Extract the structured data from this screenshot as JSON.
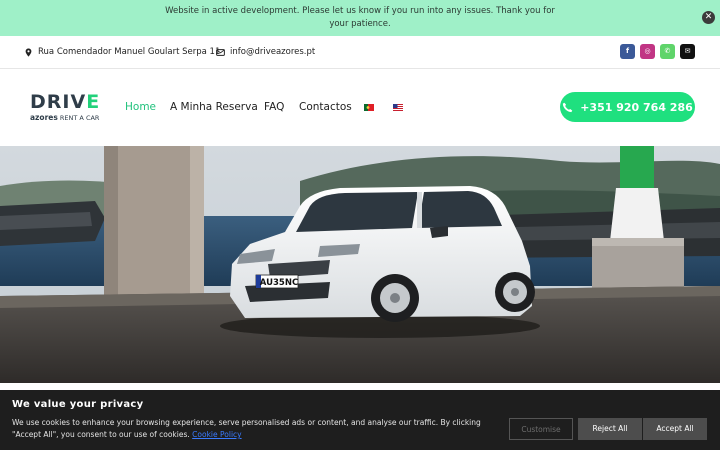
{
  "notice": {
    "text": "Website in active development. Please let us know if you run into any issues. Thank you for your patience.",
    "close_icon": "close-icon"
  },
  "contact": {
    "address": "Rua Comendador Manuel Goulart Serpa 11",
    "email": "info@driveazores.pt",
    "social": [
      {
        "name": "facebook",
        "glyph": "f",
        "color": "#3b5998"
      },
      {
        "name": "instagram",
        "glyph": "◎",
        "color": "#c13584"
      },
      {
        "name": "whatsapp",
        "glyph": "✆",
        "color": "#5fd46a"
      },
      {
        "name": "email",
        "glyph": "✉",
        "color": "#111111"
      }
    ]
  },
  "nav": {
    "logo_main_a": "DRIV",
    "logo_main_b": "E",
    "logo_sub_a": "azores",
    "logo_sub_b": " RENT A CAR",
    "items": [
      "Home",
      "A Minha Reserva",
      "FAQ",
      "Contactos"
    ],
    "phone": "+351 920 764 286"
  },
  "hero": {
    "plate": "AU35NC"
  },
  "cookie": {
    "title": "We value your privacy",
    "text": "We use cookies to enhance your browsing experience, serve personalised ads or content, and analyse our traffic. By clicking \"Accept All\", you consent to our use of cookies.",
    "link": "Cookie Policy",
    "customise": "Customise",
    "reject": "Reject All",
    "accept": "Accept All"
  },
  "colors": {
    "notice_bg": "#9ff0c8",
    "accent": "#22c27d",
    "call_button": "#1fe07f",
    "cookie_bg": "#1e1e1e"
  }
}
